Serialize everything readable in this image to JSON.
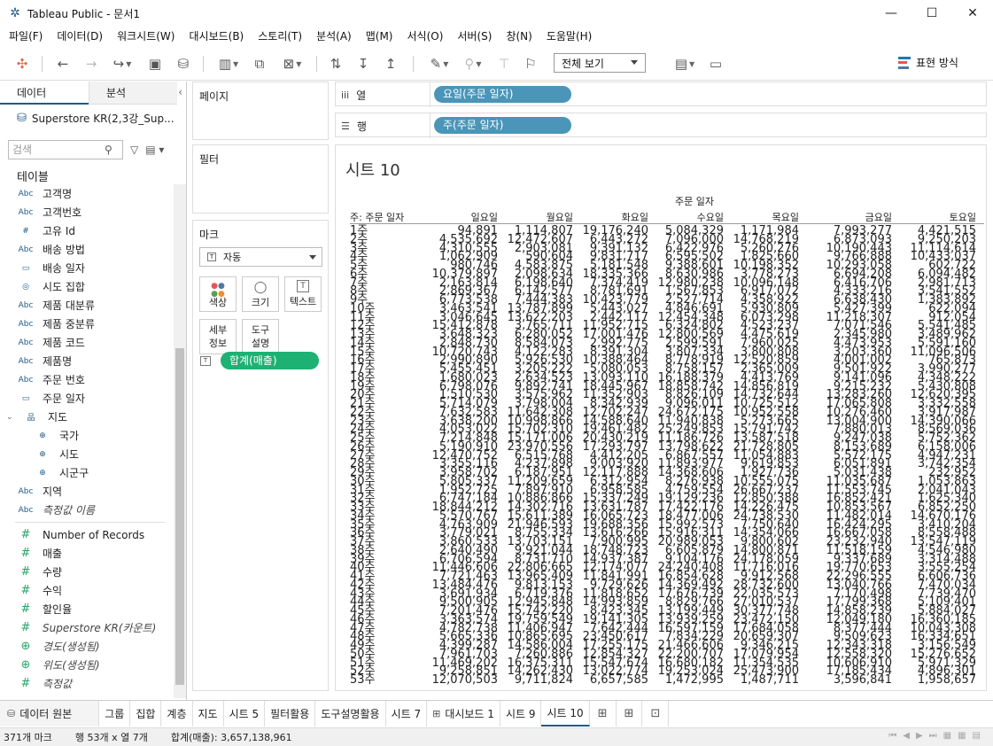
{
  "window": {
    "title": "Tableau Public - 문서1",
    "buttons": [
      "—",
      "☐",
      "✕"
    ]
  },
  "menu": [
    "파일(F)",
    "데이터(D)",
    "워크시트(W)",
    "대시보드(B)",
    "스토리(T)",
    "분석(A)",
    "맵(M)",
    "서식(O)",
    "서버(S)",
    "창(N)",
    "도움말(H)"
  ],
  "toolbar": {
    "view_select": "전체 보기",
    "show_me": "표현 방식"
  },
  "data_pane": {
    "tab_data": "데이터",
    "tab_analysis": "분석",
    "collapse": "‹",
    "datasource": "Superstore KR(2,3강_Sup...",
    "search_placeholder": "검색",
    "tables_label": "테이블",
    "dimensions": [
      {
        "icon": "Abc",
        "name": "고객명"
      },
      {
        "icon": "Abc",
        "name": "고객번호"
      },
      {
        "icon": "#",
        "name": "고유 Id"
      },
      {
        "icon": "Abc",
        "name": "배송 방법"
      },
      {
        "icon": "▭",
        "name": "배송 일자"
      },
      {
        "icon": "◎",
        "name": "시도 집합"
      },
      {
        "icon": "Abc",
        "name": "제품 대분류"
      },
      {
        "icon": "Abc",
        "name": "제품 중분류"
      },
      {
        "icon": "Abc",
        "name": "제품 코드"
      },
      {
        "icon": "Abc",
        "name": "제품명"
      },
      {
        "icon": "Abc",
        "name": "주문 번호"
      },
      {
        "icon": "▭",
        "name": "주문 일자"
      }
    ],
    "hierarchy": {
      "name": "지도",
      "tri": "⌄",
      "icon": "品"
    },
    "geo_children": [
      {
        "icon": "⊕",
        "name": "국가"
      },
      {
        "icon": "⊕",
        "name": "시도"
      },
      {
        "icon": "⊕",
        "name": "시군구"
      }
    ],
    "dimension_tail": [
      {
        "icon": "Abc",
        "name": "지역",
        "italic": false
      },
      {
        "icon": "Abc",
        "name": "측정값 이름",
        "italic": true
      }
    ],
    "measures": [
      {
        "icon": "#",
        "name": "Number of Records",
        "italic": false
      },
      {
        "icon": "#",
        "name": "매출",
        "italic": false
      },
      {
        "icon": "#",
        "name": "수량",
        "italic": false
      },
      {
        "icon": "#",
        "name": "수익",
        "italic": false
      },
      {
        "icon": "#",
        "name": "할인율",
        "italic": false
      },
      {
        "icon": "#",
        "name": "Superstore KR(카운트)",
        "italic": true
      },
      {
        "icon": "⊕",
        "name": "경도(생성됨)",
        "italic": true
      },
      {
        "icon": "⊕",
        "name": "위도(생성됨)",
        "italic": true
      },
      {
        "icon": "#",
        "name": "측정값",
        "italic": true
      }
    ]
  },
  "cards": {
    "pages": "페이지",
    "filters": "필터",
    "marks": "마크",
    "marks_type": "자동",
    "mark_buttons": [
      {
        "icon": "●",
        "label": "색상"
      },
      {
        "icon": "◯",
        "label": "크기"
      },
      {
        "icon": "T",
        "label": "텍스트"
      },
      {
        "icon": "",
        "label": "세부\n정보"
      },
      {
        "icon": "",
        "label": "도구\n설명"
      }
    ],
    "measure_pill": "합계(매출)",
    "measure_pill_icon": "T"
  },
  "shelves": {
    "columns_label": "열",
    "columns_icon": "iii",
    "columns_pill": "요일(주문 일자)",
    "rows_label": "행",
    "rows_icon": "☰",
    "rows_pill": "주(주문 일자)"
  },
  "sheet": {
    "title": "시트 10",
    "column_header_title": "주문 일자",
    "row_header_label": "주: 주문 일자",
    "columns": [
      "일요일",
      "월요일",
      "화요일",
      "수요일",
      "목요일",
      "금요일",
      "토요일"
    ],
    "rows": [
      {
        "week": "1주",
        "values": [
          "94,891",
          "1,114,807",
          "19,176,240",
          "5,084,329",
          "1,171,984",
          "7,993,277",
          "4,421,515"
        ]
      },
      {
        "week": "2주",
        "values": [
          "4,535,692",
          "12,472,607",
          "6,443,272",
          "7,096,000",
          "14,768,219",
          "6,873,093",
          "9,250,203"
        ]
      },
      {
        "week": "3주",
        "values": [
          "4,310,555",
          "2,903,081",
          "9,391,132",
          "6,422,976",
          "5,260,276",
          "10,190,443",
          "11,114,614"
        ]
      },
      {
        "week": "4주",
        "values": [
          "1,062,909",
          "590,604",
          "9,831,717",
          "6,595,502",
          "1,825,660",
          "9,766,888",
          "10,433,037"
        ]
      },
      {
        "week": "5주",
        "values": [
          "980,746",
          "4,583,875",
          "5,181,548",
          "9,388,601",
          "10,198,352",
          "10,293,058",
          "602,722"
        ]
      },
      {
        "week": "6주",
        "values": [
          "10,379,897",
          "2,098,634",
          "18,335,366",
          "8,630,986",
          "3,778,273",
          "6,694,208",
          "6,094,482"
        ]
      },
      {
        "week": "7주",
        "values": [
          "2,163,814",
          "6,198,640",
          "7,374,419",
          "12,980,238",
          "10,096,148",
          "6,416,706",
          "2,981,713"
        ]
      },
      {
        "week": "8주",
        "values": [
          "2,869,367",
          "6,142,577",
          "8,781,691",
          "1,567,853",
          "6,917,072",
          "4,333,216",
          "3,541,552"
        ]
      },
      {
        "week": "9주",
        "values": [
          "6,773,538",
          "7,444,383",
          "10,423,779",
          "2,527,714",
          "4,358,922",
          "6,638,430",
          "1,383,892"
        ]
      },
      {
        "week": "10주",
        "values": [
          "3,463,541",
          "13,787,899",
          "5,443,027",
          "4,846,691",
          "5,930,809",
          "5,427,399",
          "622,094"
        ]
      },
      {
        "week": "11주",
        "values": [
          "3,046,645",
          "13,622,203",
          "2,442,117",
          "12,454,348",
          "6,073,298",
          "11,218,307",
          "912,054"
        ]
      },
      {
        "week": "12주",
        "values": [
          "15,412,878",
          "3,765,711",
          "11,952,715",
          "6,324,802",
          "4,523,237",
          "7,071,546",
          "5,541,485"
        ]
      },
      {
        "week": "13주",
        "values": [
          "3,648,323",
          "6,280,052",
          "17,001,476",
          "12,800,569",
          "4,475,619",
          "2,345,980",
          "3,489,962"
        ]
      },
      {
        "week": "14주",
        "values": [
          "2,848,730",
          "8,584,073",
          "2,992,775",
          "2,599,591",
          "7,960,025",
          "4,473,953",
          "5,591,160"
        ]
      },
      {
        "week": "15주",
        "values": [
          "10,720,743",
          "4,122,283",
          "8,391,304",
          "3,807,334",
          "3,800,808",
          "3,203,360",
          "11,096,506"
        ]
      },
      {
        "week": "16주",
        "values": [
          "2,990,890",
          "5,926,530",
          "10,388,464",
          "8,778,919",
          "12,520,859",
          "4,001,002",
          "765,873"
        ]
      },
      {
        "week": "17주",
        "values": [
          "5,455,451",
          "3,205,222",
          "5,080,053",
          "8,758,157",
          "2,365,009",
          "9,501,922",
          "3,990,277"
        ]
      },
      {
        "week": "18주",
        "values": [
          "1,680,023",
          "2,634,523",
          "13,093,110",
          "16,188,379",
          "4,413,769",
          "9,141,096",
          "4,348,222"
        ]
      },
      {
        "week": "19주",
        "values": [
          "6,798,076",
          "9,892,741",
          "18,445,967",
          "18,858,742",
          "14,856,819",
          "9,215,232",
          "5,430,808"
        ]
      },
      {
        "week": "20주",
        "values": [
          "1,510,530",
          "3,575,962",
          "11,352,903",
          "8,826,109",
          "14,732,644",
          "13,283,260",
          "12,620,395"
        ]
      },
      {
        "week": "21주",
        "values": [
          "5,714,079",
          "3,798,004",
          "8,342,939",
          "9,096,011",
          "10,725,512",
          "17,065,808",
          "3,332,558"
        ]
      },
      {
        "week": "22주",
        "values": [
          "7,632,583",
          "11,642,308",
          "12,702,247",
          "24,672,175",
          "10,952,558",
          "10,276,460",
          "3,917,987"
        ]
      },
      {
        "week": "23주",
        "values": [
          "3,638,200",
          "10,998,866",
          "14,588,640",
          "11,940,838",
          "5,273,665",
          "13,004,900",
          "14,390,066"
        ]
      },
      {
        "week": "24주",
        "values": [
          "4,053,022",
          "15,702,310",
          "19,461,482",
          "25,249,853",
          "15,791,742",
          "7,880,013",
          "8,569,036"
        ]
      },
      {
        "week": "25주",
        "values": [
          "7,214,848",
          "15,171,006",
          "20,430,219",
          "11,186,726",
          "13,587,518",
          "9,247,038",
          "5,752,362"
        ]
      },
      {
        "week": "26주",
        "values": [
          "5,190,910",
          "23,970,556",
          "17,293,797",
          "13,798,622",
          "21,728,805",
          "8,153,689",
          "6,158,006"
        ]
      },
      {
        "week": "27주",
        "values": [
          "12,470,752",
          "6,515,768",
          "4,412,205",
          "6,867,557",
          "11,054,883",
          "5,572,175",
          "4,947,231"
        ]
      },
      {
        "week": "28주",
        "values": [
          "3,355,116",
          "4,237,898",
          "9,003,920",
          "11,893,977",
          "9,619,853",
          "6,051,891",
          "3,742,354"
        ]
      },
      {
        "week": "29주",
        "values": [
          "3,958,702",
          "6,187,951",
          "12,117,888",
          "14,368,606",
          "1,927,736",
          "5,031,438",
          "232,952"
        ]
      },
      {
        "week": "30주",
        "values": [
          "5,805,337",
          "11,209,659",
          "6,312,954",
          "8,276,938",
          "10,555,075",
          "11,035,687",
          "1,053,863"
        ]
      },
      {
        "week": "31주",
        "values": [
          "1,952,725",
          "7,897,910",
          "6,958,585",
          "4,759,554",
          "26,667,237",
          "11,553,745",
          "2,041,043"
        ]
      },
      {
        "week": "32주",
        "values": [
          "6,747,184",
          "10,886,866",
          "15,337,249",
          "19,129,236",
          "12,850,388",
          "16,852,421",
          "1,625,340"
        ]
      },
      {
        "week": "33주",
        "values": [
          "18,844,212",
          "14,302,716",
          "13,631,787",
          "17,422,176",
          "14,226,475",
          "10,853,567",
          "6,852,250"
        ]
      },
      {
        "week": "34주",
        "values": [
          "5,570,767",
          "15,611,389",
          "16,065,723",
          "18,477,006",
          "24,738,530",
          "11,482,014",
          "14,670,176"
        ]
      },
      {
        "week": "35주",
        "values": [
          "4,763,909",
          "21,946,593",
          "19,688,356",
          "15,992,573",
          "7,750,640",
          "16,424,295",
          "3,410,204"
        ]
      },
      {
        "week": "36주",
        "values": [
          "3,779,021",
          "8,755,334",
          "13,616,266",
          "15,916,311",
          "14,354,066",
          "16,667,058",
          "8,558,488"
        ]
      },
      {
        "week": "37주",
        "values": [
          "3,860,533",
          "13,703,151",
          "7,900,995",
          "20,989,053",
          "9,800,602",
          "23,232,940",
          "13,547,119"
        ]
      },
      {
        "week": "38주",
        "values": [
          "2,640,490",
          "9,921,044",
          "18,748,723",
          "6,605,879",
          "14,800,871",
          "11,518,159",
          "4,546,980"
        ]
      },
      {
        "week": "39주",
        "values": [
          "6,706,594",
          "8,731,710",
          "14,937,387",
          "9,104,176",
          "24,178,059",
          "9,337,689",
          "3,314,488"
        ]
      },
      {
        "week": "40주",
        "values": [
          "11,446,606",
          "22,806,665",
          "12,174,077",
          "24,240,408",
          "11,716,016",
          "19,770,653",
          "3,555,254"
        ]
      },
      {
        "week": "41주",
        "values": [
          "7,721,463",
          "13,965,409",
          "11,841,991",
          "16,854,628",
          "9,912,568",
          "22,296,555",
          "6,606,736"
        ]
      },
      {
        "week": "42주",
        "values": [
          "13,484,476",
          "9,813,153",
          "9,729,626",
          "14,369,492",
          "28,732,600",
          "13,040,766",
          "7,470,034"
        ]
      },
      {
        "week": "43주",
        "values": [
          "3,691,934",
          "6,719,376",
          "11,818,652",
          "17,676,739",
          "22,035,573",
          "7,170,498",
          "7,739,470"
        ]
      },
      {
        "week": "44주",
        "values": [
          "9,500,905",
          "12,945,848",
          "14,993,859",
          "8,829,766",
          "27,010,537",
          "17,799,368",
          "5,109,401"
        ]
      },
      {
        "week": "45주",
        "values": [
          "7,201,476",
          "15,742,220",
          "8,423,345",
          "13,199,449",
          "30,377,748",
          "14,858,239",
          "5,884,027"
        ]
      },
      {
        "week": "46주",
        "values": [
          "3,363,574",
          "19,759,549",
          "19,141,305",
          "13,939,259",
          "23,472,150",
          "12,049,180",
          "16,360,185"
        ]
      },
      {
        "week": "47주",
        "values": [
          "4,782,738",
          "11,406,947",
          "7,642,444",
          "16,597,159",
          "17,684,058",
          "8,377,444",
          "10,043,308"
        ]
      },
      {
        "week": "48주",
        "values": [
          "5,665,336",
          "10,865,695",
          "23,450,617",
          "7,834,229",
          "20,659,307",
          "9,509,623",
          "16,334,651"
        ]
      },
      {
        "week": "49주",
        "values": [
          "4,399,287",
          "14,586,004",
          "17,255,175",
          "21,466,606",
          "9,346,215",
          "12,343,318",
          "3,156,549"
        ]
      },
      {
        "week": "50주",
        "values": [
          "7,961,703",
          "7,260,886",
          "12,854,327",
          "22,200,707",
          "17,079,954",
          "12,558,320",
          "15,276,652"
        ]
      },
      {
        "week": "51주",
        "values": [
          "11,469,202",
          "16,375,311",
          "15,547,674",
          "16,680,182",
          "11,354,535",
          "10,606,910",
          "5,971,329"
        ]
      },
      {
        "week": "52주",
        "values": [
          "9,258,851",
          "14,262,430",
          "13,022,774",
          "19,253,024",
          "25,473,900",
          "17,185,434",
          "4,896,301"
        ]
      },
      {
        "week": "53주",
        "values": [
          "12,070,503",
          "9,711,824",
          "6,657,585",
          "1,472,995",
          "1,487,711",
          "3,596,841",
          "1,958,657"
        ]
      }
    ]
  },
  "sheet_tabs": [
    {
      "label": "데이터 원본",
      "icon": "⛁",
      "kind": "ds"
    },
    {
      "label": "그룹"
    },
    {
      "label": "집합"
    },
    {
      "label": "계층"
    },
    {
      "label": "지도"
    },
    {
      "label": "시트 5"
    },
    {
      "label": "필터활용"
    },
    {
      "label": "도구설명활용"
    },
    {
      "label": "시트 7"
    },
    {
      "label": "대시보드 1",
      "icon": "⊞"
    },
    {
      "label": "시트 9"
    },
    {
      "label": "시트 10",
      "active": true
    }
  ],
  "status": {
    "marks": "371개 마크",
    "dims": "행 53개  x  열 7개",
    "sum": "합계(매출): 3,657,138,961"
  }
}
